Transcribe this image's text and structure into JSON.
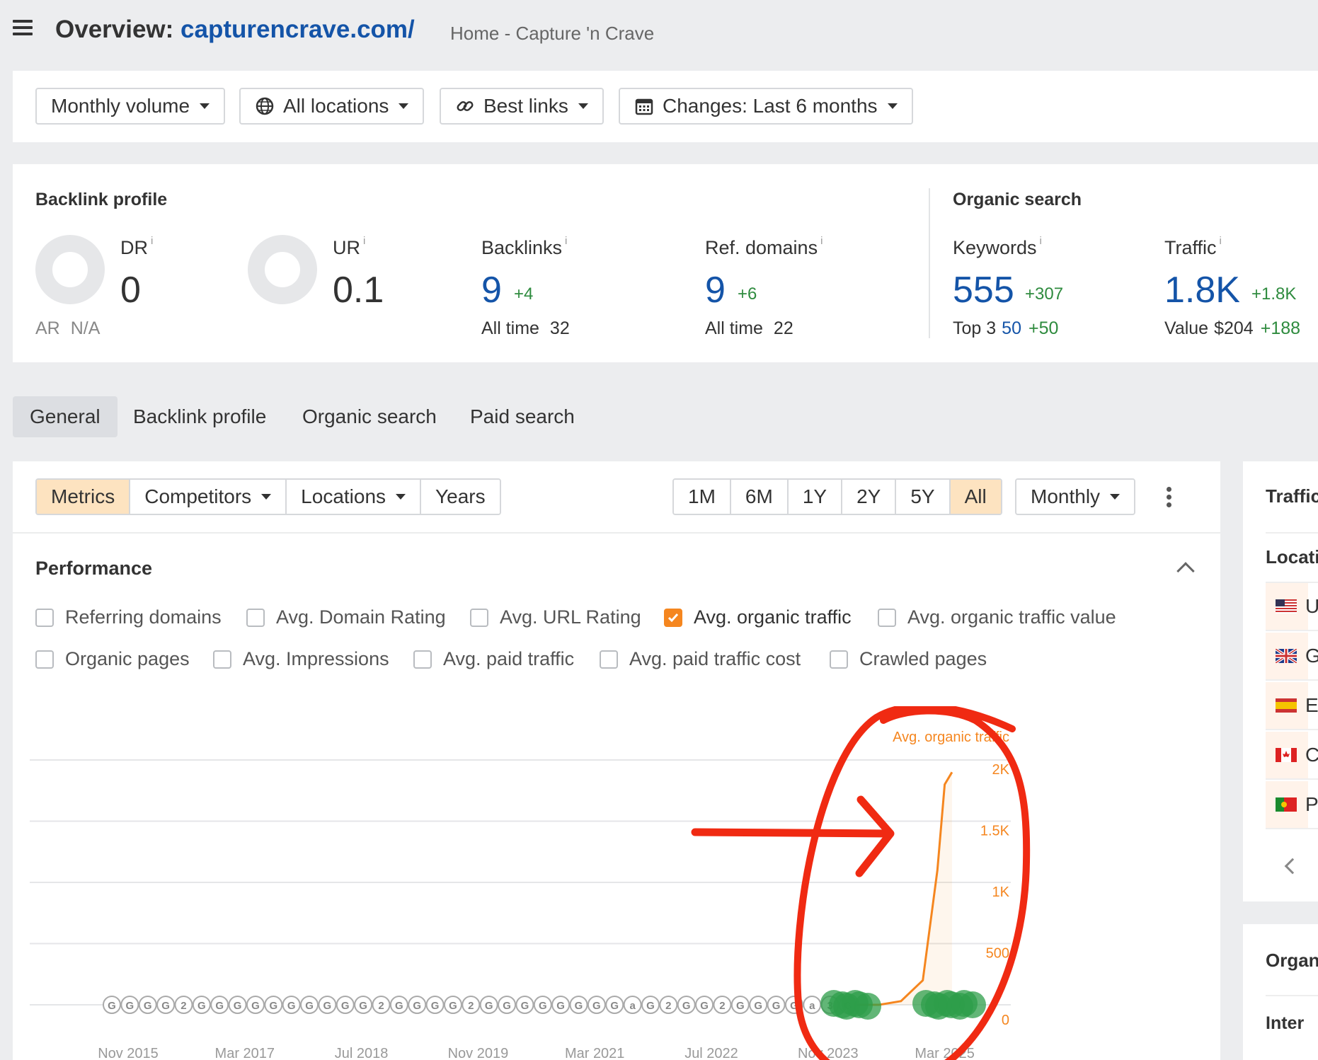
{
  "header": {
    "title_prefix": "Overview:",
    "url": "capturencrave.com/",
    "page_title": "Home - Capture 'n Crave"
  },
  "filters": {
    "volume": "Monthly volume",
    "locations": "All locations",
    "links": "Best links",
    "changes": "Changes: Last 6 months"
  },
  "backlink_profile": {
    "title": "Backlink profile",
    "dr": {
      "label": "DR",
      "value": "0"
    },
    "ur": {
      "label": "UR",
      "value": "0.1"
    },
    "ar": {
      "label": "AR",
      "value": "N/A"
    },
    "backlinks": {
      "label": "Backlinks",
      "value": "9",
      "delta": "+4",
      "alltime_label": "All time",
      "alltime": "32"
    },
    "ref_domains": {
      "label": "Ref. domains",
      "value": "9",
      "delta": "+6",
      "alltime_label": "All time",
      "alltime": "22"
    }
  },
  "organic_search": {
    "title": "Organic search",
    "keywords": {
      "label": "Keywords",
      "value": "555",
      "delta": "+307",
      "top3_label": "Top 3",
      "top3": "50",
      "top3_delta": "+50"
    },
    "traffic": {
      "label": "Traffic",
      "value": "1.8K",
      "delta": "+1.8K",
      "value_label": "Value",
      "value_amount": "$204",
      "value_delta": "+188"
    }
  },
  "info_mark": "i",
  "tabs": [
    "General",
    "Backlink profile",
    "Organic search",
    "Paid search"
  ],
  "chart_toolbar": {
    "metrics": "Metrics",
    "competitors": "Competitors",
    "locations": "Locations",
    "years": "Years",
    "ranges": [
      "1M",
      "6M",
      "1Y",
      "2Y",
      "5Y",
      "All"
    ],
    "active_range": "All",
    "interval": "Monthly"
  },
  "performance": {
    "title": "Performance",
    "checkboxes_row1": [
      {
        "label": "Referring domains",
        "checked": false
      },
      {
        "label": "Avg. Domain Rating",
        "checked": false
      },
      {
        "label": "Avg. URL Rating",
        "checked": false
      },
      {
        "label": "Avg. organic traffic",
        "checked": true
      },
      {
        "label": "Avg. organic traffic value",
        "checked": false
      }
    ],
    "checkboxes_row2": [
      {
        "label": "Organic pages",
        "checked": false
      },
      {
        "label": "Avg. Impressions",
        "checked": false
      },
      {
        "label": "Avg. paid traffic",
        "checked": false
      },
      {
        "label": "Avg. paid traffic cost",
        "checked": false
      },
      {
        "label": "Crawled pages",
        "checked": false
      }
    ]
  },
  "chart_data": {
    "type": "line",
    "series": [
      {
        "name": "Avg. organic traffic",
        "color": "#f5861f"
      }
    ],
    "legend_fragment": "Avg. organic traffic",
    "x_ticks": [
      "Nov 2015",
      "Mar 2017",
      "Jul 2018",
      "Nov 2019",
      "Mar 2021",
      "Jul 2022",
      "Nov 2023",
      "Mar 2025"
    ],
    "y_ticks": [
      "0",
      "500",
      "1K",
      "1.5K",
      "2K"
    ],
    "ylim": [
      0,
      2000
    ],
    "points": [
      {
        "x": "2015-11",
        "y": 0
      },
      {
        "x": "2023-12",
        "y": 0
      },
      {
        "x": "2024-06",
        "y": 0
      },
      {
        "x": "2024-09",
        "y": 30
      },
      {
        "x": "2024-12",
        "y": 200
      },
      {
        "x": "2025-02",
        "y": 1100
      },
      {
        "x": "2025-03",
        "y": 1800
      },
      {
        "x": "2025-04",
        "y": 1900
      }
    ],
    "annotation_markers": [
      "G",
      "G",
      "G",
      "G",
      "2",
      "G",
      "G",
      "G",
      "G",
      "G",
      "G",
      "G",
      "G",
      "G",
      "G",
      "2",
      "G",
      "G",
      "G",
      "G",
      "2",
      "G",
      "G",
      "G",
      "G",
      "G",
      "G",
      "G",
      "G",
      "a",
      "G",
      "2",
      "G",
      "G",
      "2",
      "G",
      "G",
      "G",
      "G",
      "a",
      "3",
      "G"
    ],
    "grid": true,
    "annotations": {
      "drawn_circle": "red",
      "drawn_arrow": "red"
    }
  },
  "side_panel": {
    "title": "Traffic",
    "locations_title": "Locations",
    "countries": [
      "U",
      "G",
      "E",
      "C",
      "P"
    ],
    "organic_title": "Organ",
    "intent_title": "Inter"
  },
  "colors": {
    "brand_blue": "#1454a8",
    "accent_orange": "#f5861f",
    "positive_green": "#2e8b3e",
    "active_tab_bg": "#fde3c0"
  }
}
